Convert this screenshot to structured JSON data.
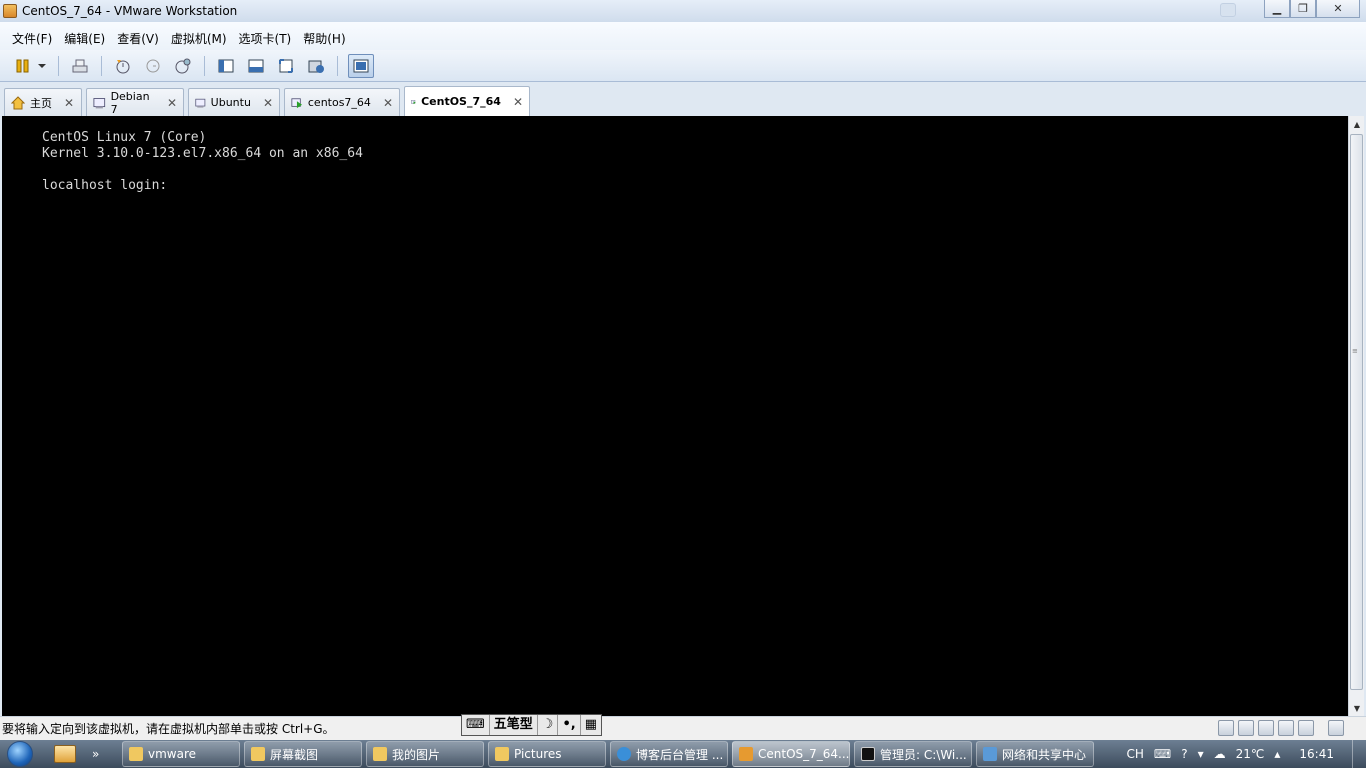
{
  "window": {
    "title": "CentOS_7_64 - VMware Workstation"
  },
  "menu": [
    "文件(F)",
    "编辑(E)",
    "查看(V)",
    "虚拟机(M)",
    "选项卡(T)",
    "帮助(H)"
  ],
  "toolbar": {
    "icons": [
      "pause-icon",
      "dropdown-icon",
      "send-keys-icon",
      "snapshot-take-icon",
      "snapshot-revert-icon",
      "snapshot-manager-icon",
      "view-library-icon",
      "view-thumbnail-icon",
      "fullscreen-icon",
      "unity-icon",
      "console-view-icon"
    ]
  },
  "tabs": [
    {
      "label": "主页",
      "icon": "home-icon",
      "active": false
    },
    {
      "label": "Debian 7",
      "icon": "vm-icon",
      "active": false
    },
    {
      "label": "Ubuntu",
      "icon": "vm-icon",
      "active": false
    },
    {
      "label": "centos7_64",
      "icon": "vm-running-icon",
      "active": false
    },
    {
      "label": "CentOS_7_64",
      "icon": "vm-running-icon",
      "active": true
    }
  ],
  "console": {
    "lines": [
      "CentOS Linux 7 (Core)",
      "Kernel 3.10.0-123.el7.x86_64 on an x86_64",
      "",
      "localhost login:"
    ]
  },
  "statusbar": {
    "message": "要将输入定向到该虚拟机，请在虚拟机内部单击或按 Ctrl+G。"
  },
  "ime": {
    "mode": "五笔型"
  },
  "taskbar": {
    "items": [
      {
        "label": "vmware",
        "icon": "folder-icon",
        "active": false
      },
      {
        "label": "屏幕截图",
        "icon": "folder-icon",
        "active": false
      },
      {
        "label": "我的图片",
        "icon": "folder-icon",
        "active": false
      },
      {
        "label": "Pictures",
        "icon": "folder-icon",
        "active": false
      },
      {
        "label": "博客后台管理 ...",
        "icon": "browser-icon",
        "active": false
      },
      {
        "label": "CentOS_7_64...",
        "icon": "vmware-icon",
        "active": true
      },
      {
        "label": "管理员: C:\\Wi...",
        "icon": "cmd-icon",
        "active": false
      },
      {
        "label": "网络和共享中心",
        "icon": "network-icon",
        "active": false
      }
    ],
    "tray": {
      "lang": "CH",
      "temperature": "21℃",
      "time": "16:41"
    }
  }
}
